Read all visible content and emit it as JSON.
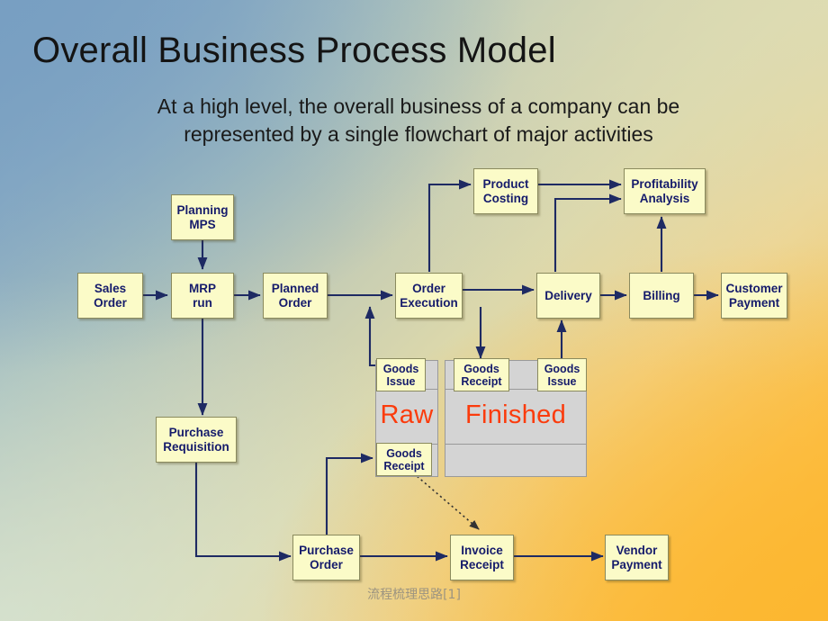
{
  "slide": {
    "title": "Overall Business Process Model",
    "subtitle_line1": "At a high level, the overall business of a company can be",
    "subtitle_line2": "represented by a single flowchart of major activities",
    "footer": "流程梳理思路[1]",
    "colors": {
      "node_fill": "#fbfbc8",
      "node_border": "#8a8a5e",
      "node_text": "#151b6b",
      "connector": "#1e2a63",
      "inventory_fill": "#d4d4d4",
      "inventory_border": "#9a9a9a",
      "inventory_label": "#fb3b0c",
      "bg_top_left": "#789fc2",
      "bg_top_right": "#dddcb4",
      "bg_bottom_left": "#d8e5d3",
      "bg_bottom_right": "#fcb730"
    }
  },
  "chart_data": {
    "type": "diagram",
    "title": "Overall Business Process Model",
    "nodes": [
      {
        "id": "sales-order",
        "label_line1": "Sales",
        "label_line2": "Order"
      },
      {
        "id": "planning-mps",
        "label_line1": "Planning",
        "label_line2": "MPS"
      },
      {
        "id": "mrp-run",
        "label_line1": "MRP",
        "label_line2": "run"
      },
      {
        "id": "planned-order",
        "label_line1": "Planned",
        "label_line2": "Order"
      },
      {
        "id": "order-execution",
        "label_line1": "Order",
        "label_line2": "Execution"
      },
      {
        "id": "product-costing",
        "label_line1": "Product",
        "label_line2": "Costing"
      },
      {
        "id": "profitability-analysis",
        "label_line1": "Profitability",
        "label_line2": "Analysis"
      },
      {
        "id": "delivery",
        "label_line1": "Delivery",
        "label_line2": ""
      },
      {
        "id": "billing",
        "label_line1": "Billing",
        "label_line2": ""
      },
      {
        "id": "customer-payment",
        "label_line1": "Customer",
        "label_line2": "Payment"
      },
      {
        "id": "purchase-requisition",
        "label_line1": "Purchase",
        "label_line2": "Requisition"
      },
      {
        "id": "purchase-order",
        "label_line1": "Purchase",
        "label_line2": "Order"
      },
      {
        "id": "invoice-receipt",
        "label_line1": "Invoice",
        "label_line2": "Receipt"
      },
      {
        "id": "vendor-payment",
        "label_line1": "Vendor",
        "label_line2": "Payment"
      }
    ],
    "inventory_blocks": [
      {
        "id": "raw-inventory",
        "label": "Raw",
        "tags": [
          {
            "id": "raw-goods-issue",
            "line1": "Goods",
            "line2": "Issue"
          },
          {
            "id": "raw-goods-receipt",
            "line1": "Goods",
            "line2": "Receipt"
          }
        ]
      },
      {
        "id": "finished-inventory",
        "label": "Finished",
        "tags": [
          {
            "id": "finished-goods-receipt",
            "line1": "Goods",
            "line2": "Receipt"
          },
          {
            "id": "finished-goods-issue",
            "line1": "Goods",
            "line2": "Issue"
          }
        ]
      }
    ],
    "edges": [
      {
        "from": "sales-order",
        "to": "mrp-run",
        "style": "solid"
      },
      {
        "from": "planning-mps",
        "to": "mrp-run",
        "style": "solid"
      },
      {
        "from": "mrp-run",
        "to": "planned-order",
        "style": "solid"
      },
      {
        "from": "mrp-run",
        "to": "purchase-requisition",
        "style": "solid"
      },
      {
        "from": "planned-order",
        "to": "order-execution",
        "style": "solid"
      },
      {
        "from": "order-execution",
        "to": "product-costing",
        "style": "solid"
      },
      {
        "from": "order-execution",
        "to": "delivery",
        "style": "solid"
      },
      {
        "from": "order-execution",
        "to": "raw-goods-issue",
        "style": "solid"
      },
      {
        "from": "order-execution",
        "to": "finished-goods-receipt",
        "style": "solid"
      },
      {
        "from": "raw-goods-issue",
        "to": "order-execution",
        "style": "solid"
      },
      {
        "from": "finished-goods-issue",
        "to": "delivery",
        "style": "solid"
      },
      {
        "from": "product-costing",
        "to": "profitability-analysis",
        "style": "solid"
      },
      {
        "from": "delivery",
        "to": "profitability-analysis",
        "style": "solid"
      },
      {
        "from": "delivery",
        "to": "billing",
        "style": "solid"
      },
      {
        "from": "billing",
        "to": "profitability-analysis",
        "style": "solid"
      },
      {
        "from": "billing",
        "to": "customer-payment",
        "style": "solid"
      },
      {
        "from": "purchase-requisition",
        "to": "purchase-order",
        "style": "solid"
      },
      {
        "from": "purchase-order",
        "to": "raw-goods-receipt",
        "style": "solid"
      },
      {
        "from": "purchase-order",
        "to": "invoice-receipt",
        "style": "solid"
      },
      {
        "from": "raw-goods-receipt",
        "to": "invoice-receipt",
        "style": "dotted"
      },
      {
        "from": "invoice-receipt",
        "to": "vendor-payment",
        "style": "solid"
      }
    ]
  }
}
